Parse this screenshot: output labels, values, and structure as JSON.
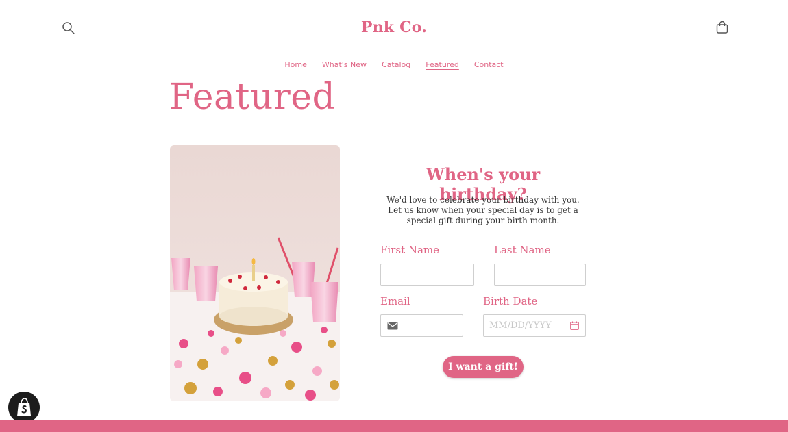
{
  "header": {
    "brand": "Pnk Co.",
    "search_icon": "search-icon",
    "cart_icon": "shopping-bag-icon"
  },
  "nav": {
    "items": [
      "Home",
      "What's New",
      "Catalog",
      "Featured",
      "Contact"
    ],
    "active": "Featured"
  },
  "page": {
    "title": "Featured"
  },
  "form": {
    "title": "When's your birthday?",
    "description": "We'd love to celebrate your birthday with you. Let us know when your special day is to get a special gift during your birth month.",
    "first_name_label": "First Name",
    "first_name_value": "",
    "last_name_label": "Last Name",
    "last_name_value": "",
    "email_label": "Email",
    "email_value": "",
    "email_icon": "mail-icon",
    "birth_date_label": "Birth Date",
    "birth_date_placeholder": "MM/DD/YYYY",
    "birth_date_icon": "calendar-icon",
    "submit_label": "I want a gift!"
  },
  "badge": {
    "icon": "shopify-bag-icon"
  },
  "colors": {
    "accent": "#e06585",
    "text": "#333333",
    "border": "#cfcfcf",
    "badge_bg": "#1c1c1c"
  }
}
